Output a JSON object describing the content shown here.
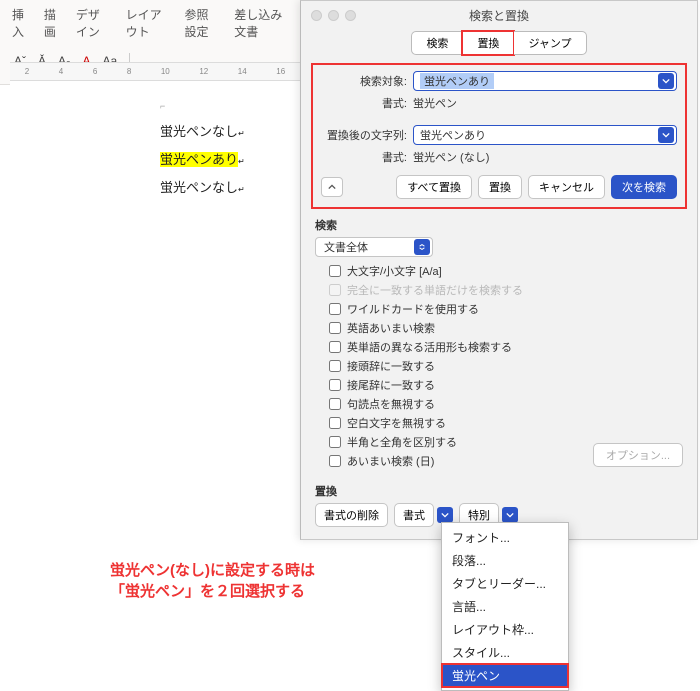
{
  "ribbon": {
    "tabs": [
      "挿入",
      "描画",
      "デザイン",
      "レイアウト",
      "参照設定",
      "差し込み文書"
    ],
    "font_btns": [
      "Aˇ",
      "Ǎ",
      "Aₐ",
      "A",
      "Aa"
    ],
    "colors": [
      "#00000000",
      "#fff",
      "#000",
      "#f33",
      "#fa0",
      "#ff0",
      "#3c3",
      "#39f",
      "#36c",
      "#93c"
    ]
  },
  "doc": {
    "lines": [
      "蛍光ペンなし",
      "蛍光ペンあり",
      "蛍光ペンなし"
    ]
  },
  "dialog": {
    "title": "検索と置換",
    "modes": {
      "find": "検索",
      "replace": "置換",
      "jump": "ジャンプ"
    },
    "find_label": "検索対象:",
    "find_value": "蛍光ペンあり",
    "fmt_label": "書式:",
    "find_fmt": "蛍光ペン",
    "repl_label": "置換後の文字列:",
    "repl_value": "蛍光ペンあり",
    "repl_fmt": "蛍光ペン (なし)",
    "buttons": {
      "replace_all": "すべて置換",
      "replace": "置換",
      "cancel": "キャンセル",
      "next": "次を検索"
    },
    "search_sec": {
      "title": "検索",
      "scope": "文書全体",
      "opts": [
        "大文字/小文字 [A/a]",
        "完全に一致する単語だけを検索する",
        "ワイルドカードを使用する",
        "英語あいまい検索",
        "英単語の異なる活用形も検索する",
        "接頭辞に一致する",
        "接尾辞に一致する",
        "句読点を無視する",
        "空白文字を無視する",
        "半角と全角を区別する",
        "あいまい検索 (日)"
      ]
    },
    "options_btn": "オプション...",
    "replace_sec": {
      "title": "置換",
      "no_fmt": "書式の削除",
      "format": "書式",
      "special": "特別"
    }
  },
  "menu": {
    "items": [
      "フォント...",
      "段落...",
      "タブとリーダー...",
      "言語...",
      "レイアウト枠...",
      "スタイル...",
      "蛍光ペン"
    ]
  },
  "annotation": {
    "l1": "蛍光ペン(なし)に設定する時は",
    "l2": "「蛍光ペン」を２回選択する"
  }
}
